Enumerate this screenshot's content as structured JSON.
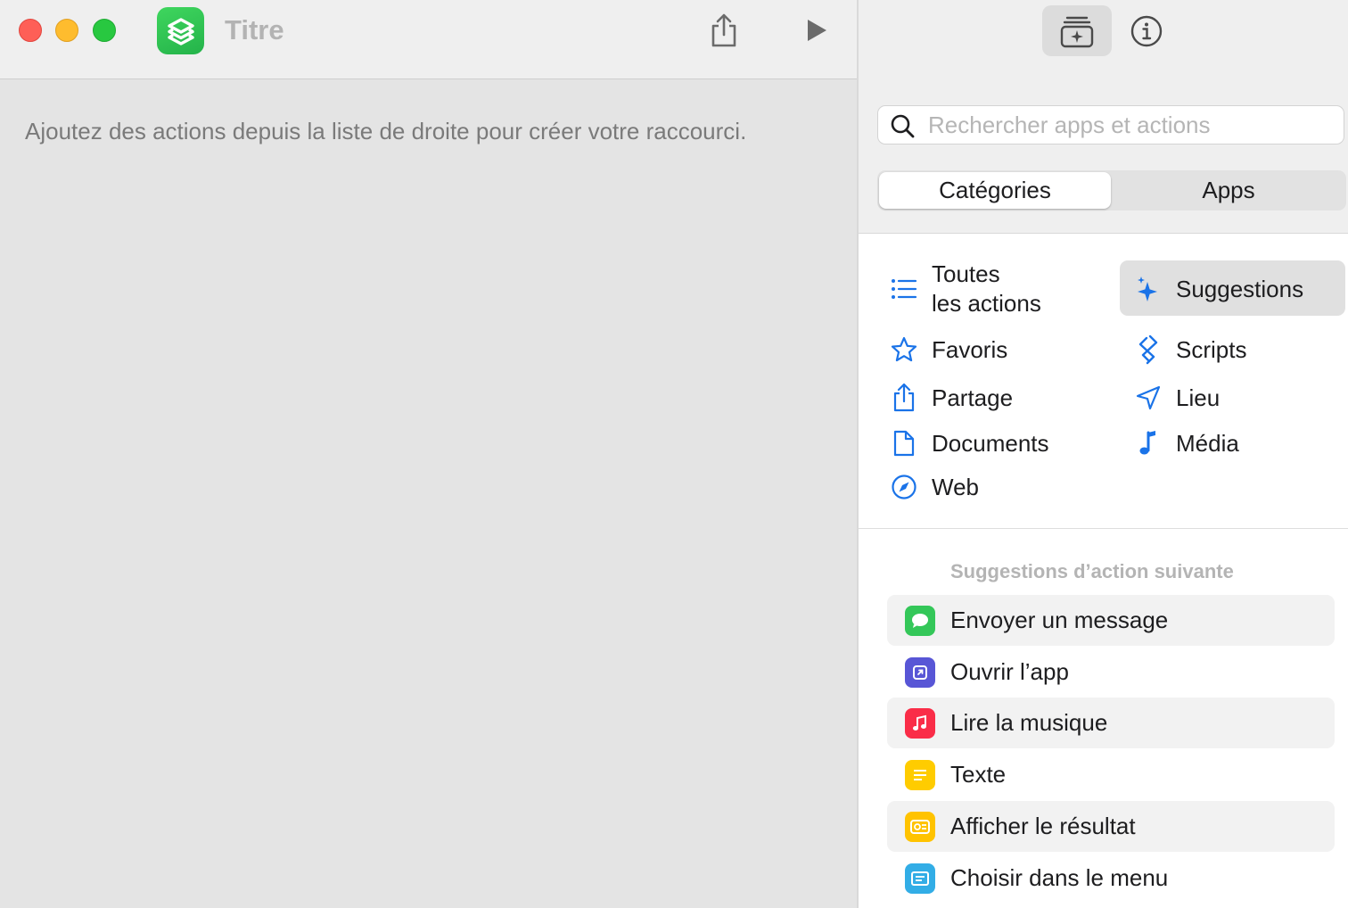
{
  "window": {
    "title": "Titre"
  },
  "editor": {
    "hint": "Ajoutez des actions depuis la liste de droite pour créer votre raccourci."
  },
  "search": {
    "placeholder": "Rechercher apps et actions"
  },
  "segmented": {
    "categories": "Catégories",
    "apps": "Apps",
    "selected": "Catégories"
  },
  "categories": {
    "all_actions_line1": "Toutes",
    "all_actions_line2": "les actions",
    "suggestions": "Suggestions",
    "favoris": "Favoris",
    "scripts": "Scripts",
    "partage": "Partage",
    "lieu": "Lieu",
    "documents": "Documents",
    "media": "Média",
    "web": "Web"
  },
  "suggestions": {
    "header": "Suggestions d’action suivante",
    "items": [
      {
        "label": "Envoyer un message",
        "icon": "messages-icon",
        "color": "#34c759"
      },
      {
        "label": "Ouvrir l’app",
        "icon": "open-app-icon",
        "color": "#5856d6"
      },
      {
        "label": "Lire la musique",
        "icon": "music-icon",
        "color": "#fa2d48"
      },
      {
        "label": "Texte",
        "icon": "text-icon",
        "color": "#ffcc00"
      },
      {
        "label": "Afficher le résultat",
        "icon": "show-result-icon",
        "color": "#ffc300"
      },
      {
        "label": "Choisir dans le menu",
        "icon": "menu-icon",
        "color": "#32ade6"
      }
    ]
  },
  "colors": {
    "accent": "#1a73e8",
    "app_icon": "#30c352"
  }
}
